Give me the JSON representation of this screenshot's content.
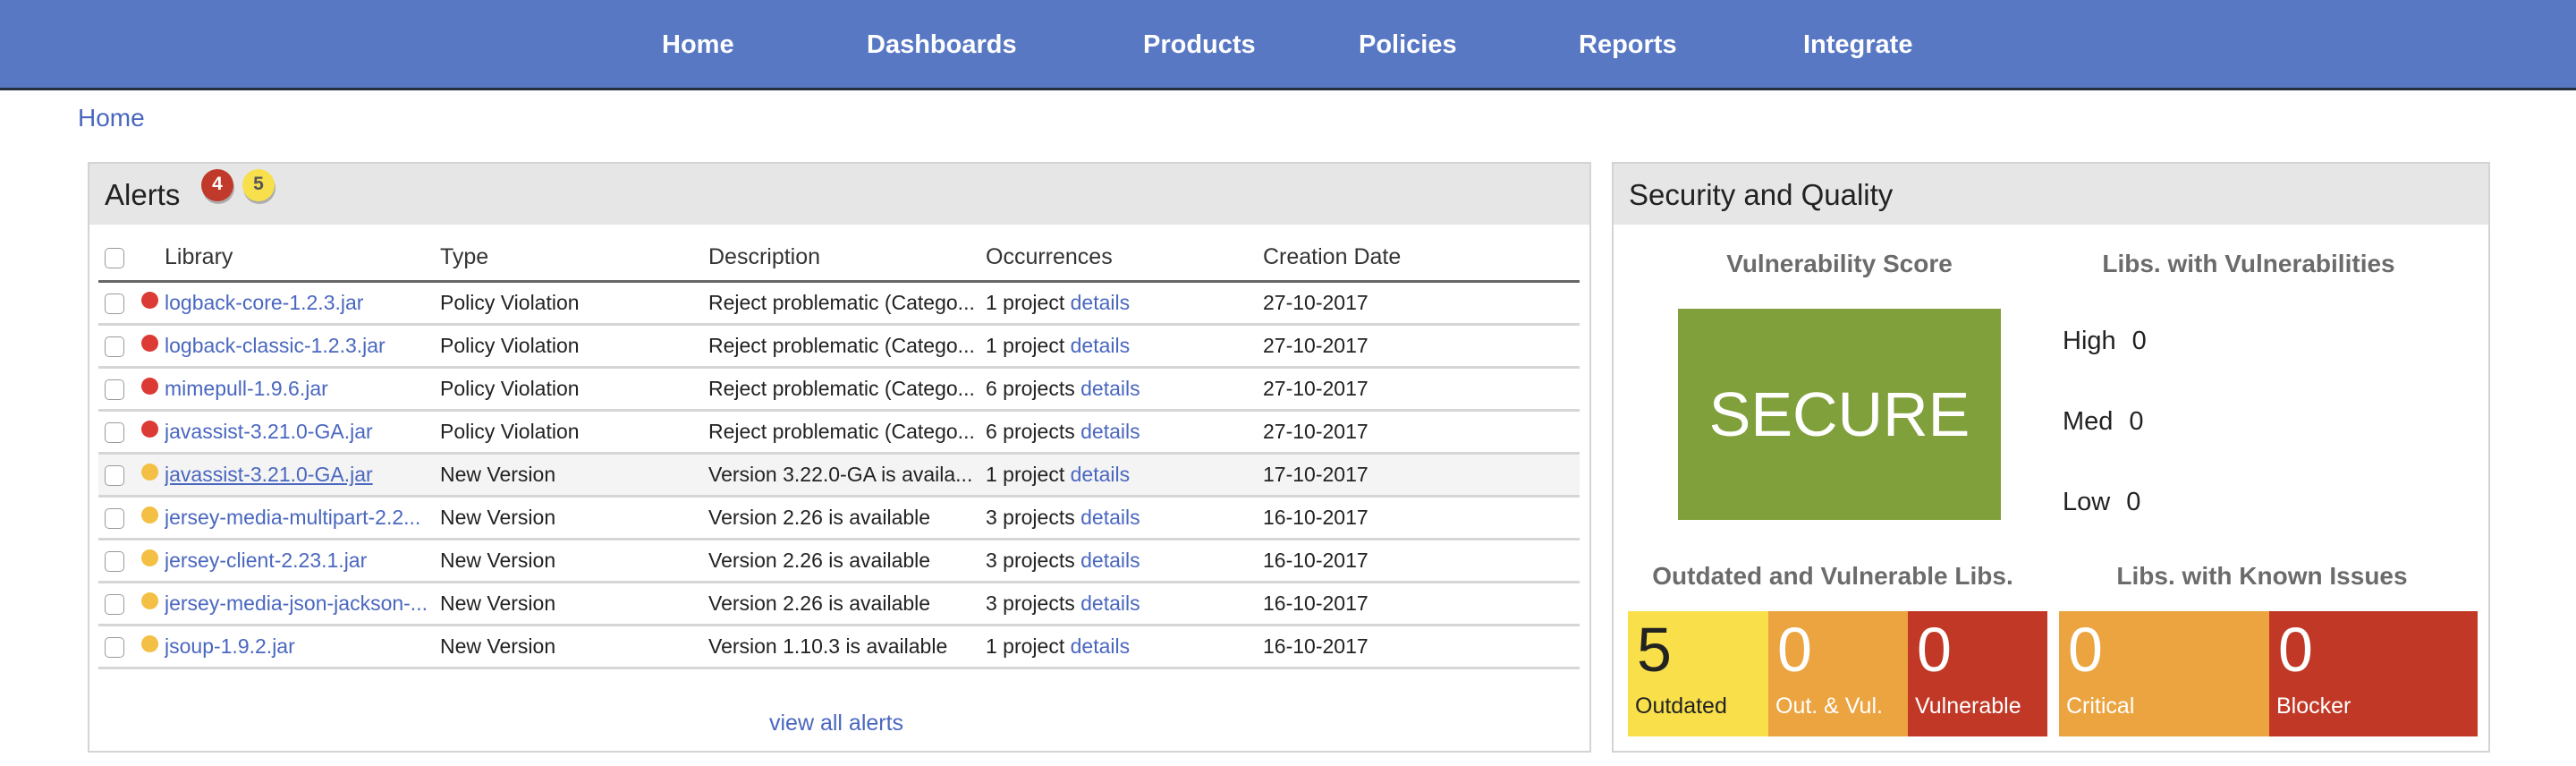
{
  "nav": {
    "items": [
      {
        "label": "Home"
      },
      {
        "label": "Dashboards"
      },
      {
        "label": "Products"
      },
      {
        "label": "Policies"
      },
      {
        "label": "Reports"
      },
      {
        "label": "Integrate"
      }
    ]
  },
  "breadcrumb": {
    "label": "Home"
  },
  "alerts": {
    "title": "Alerts",
    "badges": {
      "red": "4",
      "yellow": "5"
    },
    "columns": [
      "Library",
      "Type",
      "Description",
      "Occurrences",
      "Creation Date"
    ],
    "rows": [
      {
        "severity": "red",
        "library": "logback-core-1.2.3.jar",
        "type": "Policy Violation",
        "description": "Reject problematic (Catego...",
        "occurrences": "1 project",
        "details": "details",
        "date": "27-10-2017"
      },
      {
        "severity": "red",
        "library": "logback-classic-1.2.3.jar",
        "type": "Policy Violation",
        "description": "Reject problematic (Catego...",
        "occurrences": "1 project",
        "details": "details",
        "date": "27-10-2017"
      },
      {
        "severity": "red",
        "library": "mimepull-1.9.6.jar",
        "type": "Policy Violation",
        "description": "Reject problematic (Catego...",
        "occurrences": "6 projects",
        "details": "details",
        "date": "27-10-2017"
      },
      {
        "severity": "red",
        "library": "javassist-3.21.0-GA.jar",
        "type": "Policy Violation",
        "description": "Reject problematic (Catego...",
        "occurrences": "6 projects",
        "details": "details",
        "date": "27-10-2017"
      },
      {
        "severity": "yellow",
        "library": "javassist-3.21.0-GA.jar",
        "type": "New Version",
        "description": "Version 3.22.0-GA is availa...",
        "occurrences": "1 project",
        "details": "details",
        "date": "17-10-2017"
      },
      {
        "severity": "yellow",
        "library": "jersey-media-multipart-2.2...",
        "type": "New Version",
        "description": "Version 2.26 is available",
        "occurrences": "3 projects",
        "details": "details",
        "date": "16-10-2017"
      },
      {
        "severity": "yellow",
        "library": "jersey-client-2.23.1.jar",
        "type": "New Version",
        "description": "Version 2.26 is available",
        "occurrences": "3 projects",
        "details": "details",
        "date": "16-10-2017"
      },
      {
        "severity": "yellow",
        "library": "jersey-media-json-jackson-...",
        "type": "New Version",
        "description": "Version 2.26 is available",
        "occurrences": "3 projects",
        "details": "details",
        "date": "16-10-2017"
      },
      {
        "severity": "yellow",
        "library": "jsoup-1.9.2.jar",
        "type": "New Version",
        "description": "Version 1.10.3 is available",
        "occurrences": "1 project",
        "details": "details",
        "date": "16-10-2017"
      }
    ],
    "view_all": "view all alerts"
  },
  "security": {
    "title": "Security and Quality",
    "vulnerability_score": {
      "heading": "Vulnerability Score",
      "value": "SECURE"
    },
    "libs_with_vulnerabilities": {
      "heading": "Libs. with Vulnerabilities",
      "items": [
        {
          "label": "High",
          "value": "0"
        },
        {
          "label": "Med",
          "value": "0"
        },
        {
          "label": "Low",
          "value": "0"
        }
      ]
    },
    "outdated_vulnerable": {
      "heading": "Outdated and Vulnerable Libs.",
      "tiles": [
        {
          "value": "5",
          "label": "Outdated"
        },
        {
          "value": "0",
          "label": "Out. & Vul."
        },
        {
          "value": "0",
          "label": "Vulnerable"
        }
      ]
    },
    "known_issues": {
      "heading": "Libs. with Known Issues",
      "tiles": [
        {
          "value": "0",
          "label": "Critical"
        },
        {
          "value": "0",
          "label": "Blocker"
        }
      ]
    }
  },
  "colors": {
    "nav_bg": "#5878c4",
    "link": "#4a67bf",
    "secure_green": "#80a03c",
    "yellow": "#f9e04b",
    "orange": "#eba440",
    "red": "#c13826",
    "dot_red": "#dc3a35",
    "dot_yellow": "#f3bf44"
  }
}
